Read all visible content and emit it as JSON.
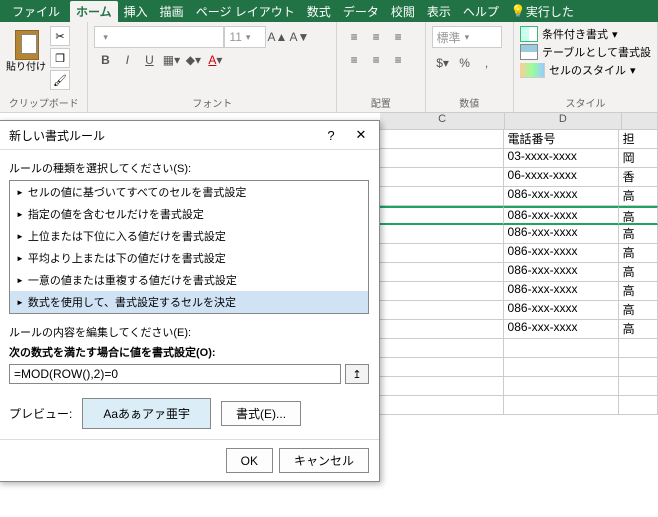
{
  "titlebar": {
    "file": "ファイル",
    "tabs": [
      "ホーム",
      "挿入",
      "描画",
      "ページ レイアウト",
      "数式",
      "データ",
      "校閲",
      "表示",
      "ヘルプ"
    ],
    "tellme_icon": "lightbulb-icon",
    "tellme": "実行した",
    "activeTab": 0
  },
  "ribbon": {
    "clipboard": {
      "paste": "貼り付け",
      "label": "クリップボード"
    },
    "font": {
      "sizePlaceholder": "11",
      "label": "フォント",
      "bold": "B",
      "italic": "I",
      "underline": "U"
    },
    "align": {
      "label": "配置"
    },
    "number": {
      "std": "標準",
      "label": "数値"
    },
    "styles": {
      "cond": "条件付き書式",
      "table": "テーブルとして書式設",
      "cell": "セルのスタイル",
      "label": "スタイル"
    }
  },
  "sheet": {
    "cols": [
      "C",
      "D",
      ""
    ],
    "header": {
      "c": "",
      "d": "電話番号",
      "e": "担"
    },
    "rows": [
      {
        "c": "",
        "d": "03-xxxx-xxxx",
        "e": "岡"
      },
      {
        "c": "",
        "d": "06-xxxx-xxxx",
        "e": "香"
      },
      {
        "c": "",
        "d": "086-xxx-xxxx",
        "e": "高"
      },
      {
        "c": "",
        "d": "086-xxx-xxxx",
        "e": "高",
        "sel": true
      },
      {
        "c": "",
        "d": "086-xxx-xxxx",
        "e": "高"
      },
      {
        "c": "",
        "d": "086-xxx-xxxx",
        "e": "高"
      },
      {
        "c": "",
        "d": "086-xxx-xxxx",
        "e": "高"
      },
      {
        "c": "",
        "d": "086-xxx-xxxx",
        "e": "高"
      },
      {
        "c": "",
        "d": "086-xxx-xxxx",
        "e": "高"
      },
      {
        "c": "",
        "d": "086-xxx-xxxx",
        "e": "高"
      },
      {
        "c": "",
        "d": "",
        "e": ""
      },
      {
        "c": "",
        "d": "",
        "e": ""
      },
      {
        "c": "",
        "d": "",
        "e": ""
      },
      {
        "c": "",
        "d": "",
        "e": ""
      }
    ]
  },
  "dialog": {
    "title": "新しい書式ルール",
    "help": "?",
    "close": "✕",
    "selectLabel": "ルールの種類を選択してください(S):",
    "rules": [
      "セルの値に基づいてすべてのセルを書式設定",
      "指定の値を含むセルだけを書式設定",
      "上位または下位に入る値だけを書式設定",
      "平均より上または下の値だけを書式設定",
      "一意の値または重複する値だけを書式設定",
      "数式を使用して、書式設定するセルを決定"
    ],
    "selectedRule": 5,
    "editLabel": "ルールの内容を編集してください(E):",
    "formulaLabel": "次の数式を満たす場合に値を書式設定(O):",
    "formula": "=MOD(ROW(),2)=0",
    "previewLabel": "プレビュー:",
    "previewText": "Aaあぁアァ亜宇",
    "formatBtn": "書式(E)...",
    "ok": "OK",
    "cancel": "キャンセル"
  }
}
